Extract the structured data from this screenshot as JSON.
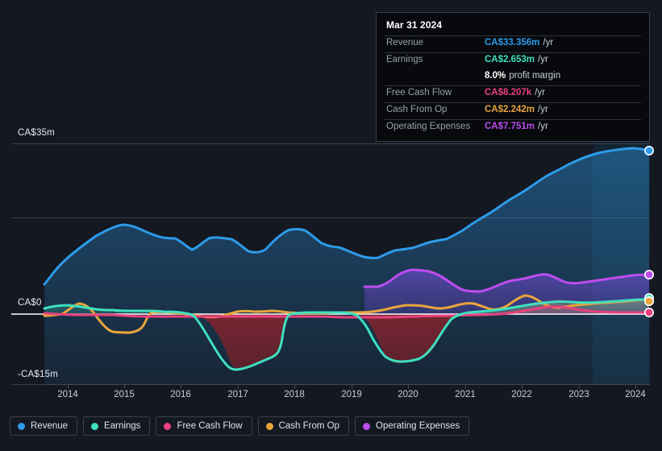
{
  "axes": {
    "y_labels": [
      "CA$35m",
      "CA$0",
      "-CA$15m"
    ],
    "x_labels": [
      "2014",
      "2015",
      "2016",
      "2017",
      "2018",
      "2019",
      "2020",
      "2021",
      "2022",
      "2023",
      "2024"
    ]
  },
  "tooltip": {
    "date": "Mar 31 2024",
    "rows": [
      {
        "label": "Revenue",
        "value": "CA$33.356m",
        "unit": "/yr",
        "color": "#2e9bea"
      },
      {
        "label": "Earnings",
        "value": "CA$2.653m",
        "unit": "/yr",
        "color": "#3fe0bf"
      },
      {
        "label": "Free Cash Flow",
        "value": "CA$8.207k",
        "unit": "/yr",
        "color": "#e8417d"
      },
      {
        "label": "Cash From Op",
        "value": "CA$2.242m",
        "unit": "/yr",
        "color": "#e9a53c"
      },
      {
        "label": "Operating Expenses",
        "value": "CA$7.751m",
        "unit": "/yr",
        "color": "#bd4ded"
      }
    ],
    "margin_value": "8.0%",
    "margin_text": "profit margin"
  },
  "legend": [
    {
      "label": "Revenue",
      "color": "#2e9bea"
    },
    {
      "label": "Earnings",
      "color": "#3fe0bf"
    },
    {
      "label": "Free Cash Flow",
      "color": "#e8417d"
    },
    {
      "label": "Cash From Op",
      "color": "#e9a53c"
    },
    {
      "label": "Operating Expenses",
      "color": "#bd4ded"
    }
  ],
  "chart_data": {
    "type": "area",
    "title": "",
    "xlabel": "",
    "ylabel": "CA$",
    "ylim": [
      -15,
      35
    ],
    "grid": true,
    "legend_position": "bottom",
    "currency": "CA$",
    "units": "millions",
    "forecast_start_x": "2023.2",
    "x": [
      2013.6,
      2014.0,
      2014.3,
      2014.6,
      2015.0,
      2015.3,
      2015.6,
      2016.0,
      2016.3,
      2016.6,
      2017.0,
      2017.3,
      2017.6,
      2018.0,
      2018.3,
      2018.6,
      2019.0,
      2019.3,
      2019.6,
      2020.0,
      2020.3,
      2020.6,
      2021.0,
      2021.3,
      2021.6,
      2022.0,
      2022.3,
      2022.6,
      2023.0,
      2023.3,
      2023.6,
      2024.0,
      2024.25
    ],
    "series": [
      {
        "name": "Revenue",
        "color": "#2e9bea",
        "values": [
          6.7,
          11.4,
          14.5,
          16.2,
          18.4,
          17.4,
          16.6,
          16.5,
          14.2,
          15.6,
          15.3,
          13.4,
          13.6,
          13.0,
          12.9,
          15.2,
          15.8,
          14.7,
          13.7,
          13.5,
          14.8,
          14.4,
          15.0,
          15.9,
          17.8,
          19.9,
          21.6,
          23.4,
          25.3,
          27.3,
          29.4,
          32.2,
          33.356
        ]
      },
      {
        "name": "Earnings",
        "color": "#3fe0bf",
        "values": [
          0.6,
          1.0,
          0.4,
          0.1,
          0.2,
          0.3,
          0.1,
          -0.6,
          -1.8,
          -5.0,
          -12.4,
          -11.6,
          -10.6,
          -0.4,
          -0.1,
          0.1,
          -0.2,
          -3.6,
          -8.8,
          -10.3,
          -10.6,
          -5.0,
          -0.9,
          -0.3,
          0.6,
          0.9,
          1.6,
          1.1,
          1.3,
          1.9,
          2.2,
          2.5,
          2.653
        ]
      },
      {
        "name": "Free Cash Flow",
        "color": "#e8417d",
        "values": [
          0.1,
          0.0,
          -0.1,
          -0.1,
          0.0,
          0.0,
          -0.1,
          -0.2,
          -0.3,
          -0.2,
          -0.2,
          -0.2,
          -0.2,
          -0.2,
          -0.2,
          -0.2,
          -0.2,
          -0.2,
          -0.3,
          -0.3,
          -0.3,
          -0.3,
          -0.2,
          0.0,
          0.3,
          0.5,
          1.0,
          0.4,
          0.1,
          0.0,
          0.0,
          0.0,
          0.008
        ]
      },
      {
        "name": "Cash From Op",
        "color": "#e9a53c",
        "values": [
          -0.4,
          -0.3,
          1.0,
          -1.6,
          -3.0,
          -3.4,
          -3.4,
          0.2,
          0.5,
          0.1,
          -0.4,
          0.4,
          0.3,
          0.6,
          0.4,
          0.2,
          0.2,
          0.3,
          0.2,
          0.3,
          0.4,
          0.9,
          1.2,
          1.3,
          0.9,
          1.4,
          2.6,
          1.3,
          1.3,
          1.6,
          1.9,
          2.1,
          2.242
        ]
      },
      {
        "name": "Operating Expenses",
        "color": "#bd4ded",
        "values": [
          null,
          null,
          null,
          null,
          null,
          null,
          null,
          null,
          null,
          null,
          null,
          null,
          null,
          null,
          null,
          null,
          3.7,
          3.7,
          7.3,
          8.4,
          8.7,
          7.1,
          4.4,
          4.4,
          4.6,
          5.8,
          6.2,
          5.4,
          5.5,
          5.9,
          6.4,
          7.2,
          7.751
        ]
      }
    ]
  }
}
